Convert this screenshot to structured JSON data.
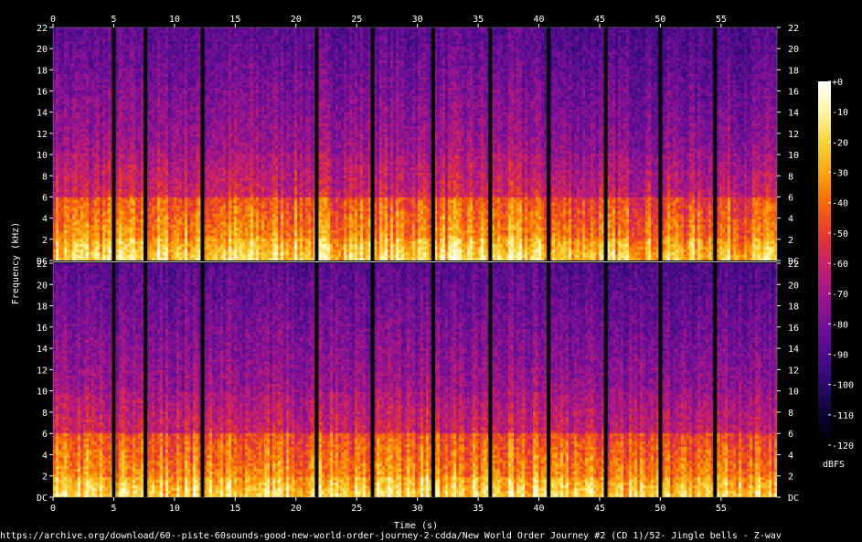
{
  "chart_data": {
    "type": "heatmap",
    "title": "",
    "xlabel": "Time (s)",
    "ylabel": "Frequency (kHz)",
    "xlim": [
      0,
      59.6
    ],
    "x_ticks": [
      0,
      5,
      10,
      15,
      20,
      25,
      30,
      35,
      40,
      45,
      50,
      55
    ],
    "x_tick_labels": [
      "0",
      "5",
      "10",
      "15",
      "20",
      "25",
      "30",
      "35",
      "40",
      "45",
      "50",
      "55"
    ],
    "ylim": [
      0,
      22
    ],
    "y_ticks": [
      0,
      2,
      4,
      6,
      8,
      10,
      12,
      14,
      16,
      18,
      20,
      22
    ],
    "y_tick_labels": [
      "DC",
      "2",
      "4",
      "6",
      "8",
      "10",
      "12",
      "14",
      "16",
      "18",
      "20",
      "22"
    ],
    "channels": 2,
    "colorbar": {
      "label": "dBFS",
      "range": [
        -120,
        0
      ],
      "ticks": [
        0,
        -10,
        -20,
        -30,
        -40,
        -50,
        -60,
        -70,
        -80,
        -90,
        -100,
        -110,
        -120
      ],
      "tick_labels": [
        "+0",
        "-10",
        "-20",
        "-30",
        "-40",
        "-50",
        "-60",
        "-70",
        "-80",
        "-90",
        "-100",
        "-110",
        "-120"
      ],
      "colors": [
        "#000000",
        "#0b0430",
        "#2a0a6e",
        "#4d0c8c",
        "#750f96",
        "#a0168a",
        "#c8206a",
        "#e63a2e",
        "#f76b0a",
        "#fba50f",
        "#f6d53a",
        "#fdf5a5",
        "#ffffff"
      ]
    },
    "silence_gaps_s": [
      5.0,
      7.6,
      12.3,
      21.7,
      26.3,
      31.3,
      36.0,
      40.8,
      45.5,
      50.0,
      54.5
    ],
    "loud_region_khz": 6,
    "peak_region_khz": 2
  },
  "footer": {
    "url": "https://archive.org/download/60--piste-60sounds-good-new-world-order-journey-2-cdda/New World Order Journey #2 (CD 1)/52- Jingle bells - Z-wav"
  }
}
